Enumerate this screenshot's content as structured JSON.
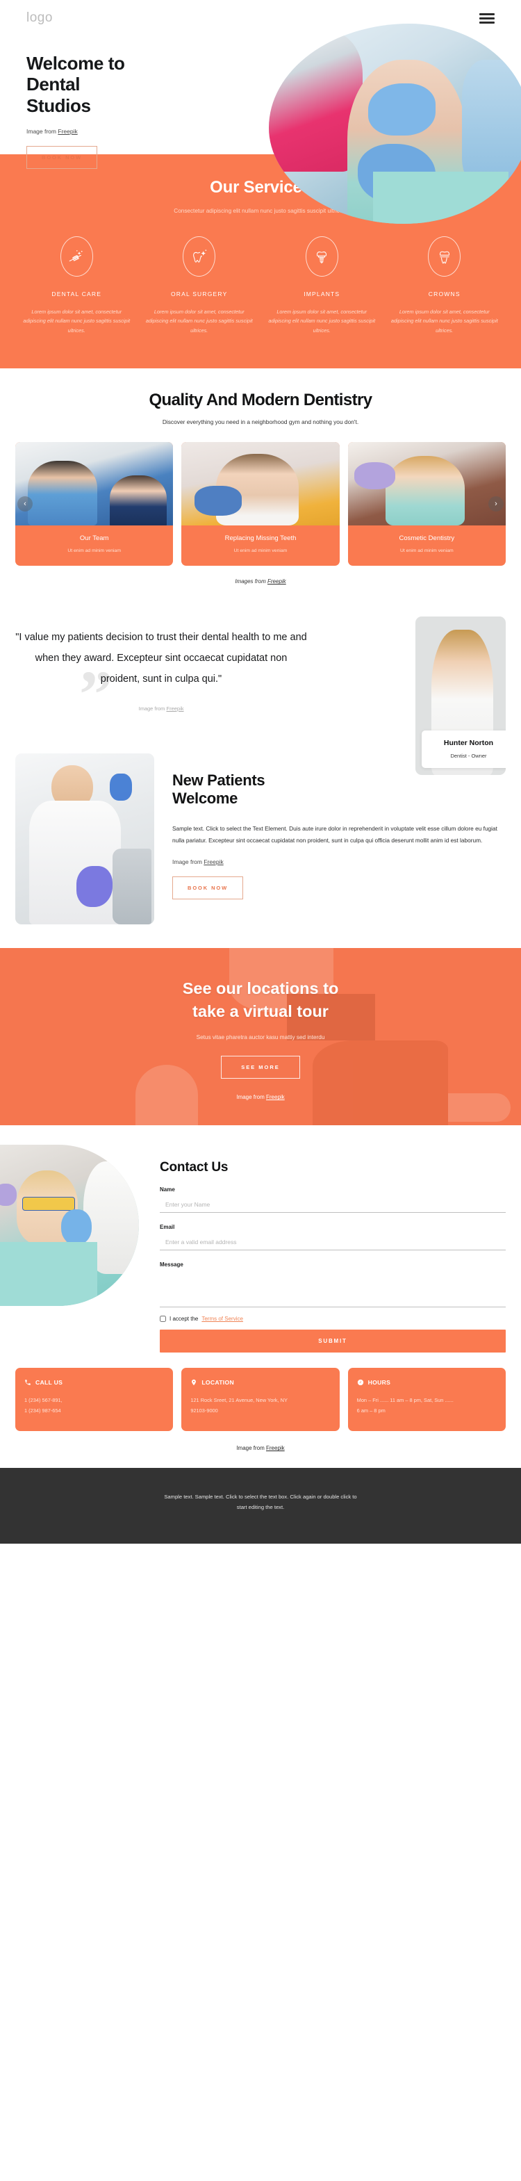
{
  "header": {
    "logo": "logo",
    "menu_icon": "hamburger-menu-icon"
  },
  "hero": {
    "title_line1": "Welcome to",
    "title_line2": "Dental",
    "title_line3": "Studios",
    "credit_prefix": "Image from ",
    "credit_link": "Freepik",
    "cta": "BOOK NOW"
  },
  "services": {
    "title": "Our Services",
    "subtitle": "Consectetur adipiscing elit nullam nunc justo sagittis suscipit ultrices.",
    "items": [
      {
        "name": "DENTAL CARE",
        "icon": "toothbrush-icon",
        "desc": "Lorem ipsum dolor sit amet, consectetur adipiscing elit nullam nunc justo sagittis suscipit ultrices."
      },
      {
        "name": "ORAL SURGERY",
        "icon": "sparkling-tooth-icon",
        "desc": "Lorem ipsum dolor sit amet, consectetur adipiscing elit nullam nunc justo sagittis suscipit ultrices."
      },
      {
        "name": "IMPLANTS",
        "icon": "dental-implant-icon",
        "desc": "Lorem ipsum dolor sit amet, consectetur adipiscing elit nullam nunc justo sagittis suscipit ultrices."
      },
      {
        "name": "CROWNS",
        "icon": "dental-crown-icon",
        "desc": "Lorem ipsum dolor sit amet, consectetur adipiscing elit nullam nunc justo sagittis suscipit ultrices."
      }
    ]
  },
  "quality": {
    "title": "Quality And Modern Dentistry",
    "subtitle": "Discover everything you need in a neighborhood gym and nothing you don't.",
    "prev_arrow": "‹",
    "next_arrow": "›",
    "cards": [
      {
        "title": "Our Team",
        "subtitle": "Ut enim ad minim veniam"
      },
      {
        "title": "Replacing Missing Teeth",
        "subtitle": "Ut enim ad minim veniam"
      },
      {
        "title": "Cosmetic Dentistry",
        "subtitle": "Ut enim ad minim veniam"
      }
    ],
    "credit_prefix": "Images from ",
    "credit_link": "Freepik"
  },
  "testimonial": {
    "quote": "\"I value my patients decision to trust their dental health to me and when they award. Excepteur sint occaecat cupidatat non proident, sunt in culpa qui.\"",
    "quote_mark": "”",
    "credit_prefix": "Image from ",
    "credit_link": "Freepik",
    "doctor_name": "Hunter Norton",
    "doctor_role": "Dentist - Owner"
  },
  "new_patients": {
    "title_line1": "New Patients",
    "title_line2": "Welcome",
    "body": "Sample text. Click to select the Text Element. Duis aute irure dolor in reprehenderit in voluptate velit esse cillum dolore eu fugiat nulla pariatur. Excepteur sint occaecat cupidatat non proident, sunt in culpa qui officia deserunt mollit anim id est laborum.",
    "credit_prefix": "Image from ",
    "credit_link": "Freepik",
    "cta": "BOOK NOW"
  },
  "tour": {
    "title_line1": "See our locations to",
    "title_line2": "take a virtual tour",
    "subtitle": "Setus vitae pharetra auctor kasu mattiy sed interdu",
    "cta": "SEE MORE",
    "credit_prefix": "Image from ",
    "credit_link": "Freepik"
  },
  "contact": {
    "title": "Contact Us",
    "name_label": "Name",
    "name_placeholder": "Enter your Name",
    "email_label": "Email",
    "email_placeholder": "Enter a valid email address",
    "message_label": "Message",
    "message_placeholder": "",
    "terms_prefix": "I accept the ",
    "terms_link": "Terms of Service",
    "submit": "SUBMIT"
  },
  "info_cards": [
    {
      "icon": "phone-icon",
      "title": "CALL US",
      "line1": "1 (234) 567-891,",
      "line2": "1 (234) 987-654"
    },
    {
      "icon": "location-pin-icon",
      "title": "LOCATION",
      "line1": "121 Rock Sreet, 21 Avenue, New York, NY",
      "line2": "92103-9000"
    },
    {
      "icon": "clock-icon",
      "title": "HOURS",
      "line1": "Mon – Fri ...... 11 am – 8 pm, Sat, Sun  ......",
      "line2": "6 am – 8 pm"
    }
  ],
  "bottom_credit": {
    "prefix": "Image from ",
    "link": "Freepik"
  },
  "footer": {
    "text": "Sample text. Sample text. Click to select the text box. Click again or double click to start editing the text."
  },
  "colors": {
    "accent": "#fa7a50",
    "accent_light": "#f5764f",
    "footer_bg": "#333333",
    "link": "#f08456"
  }
}
